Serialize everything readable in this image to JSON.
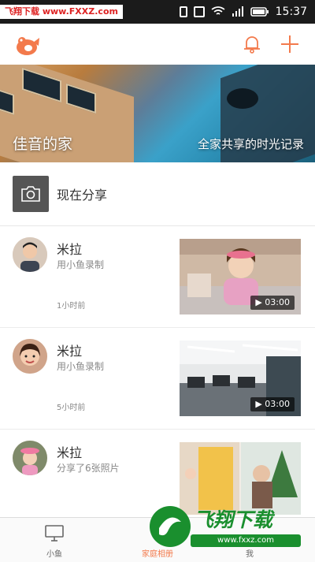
{
  "status_bar": {
    "watermark": "飞翔下载 www.FXXZ.com",
    "time": "15:37"
  },
  "app_bar": {
    "logo_icon": "fish-logo-icon",
    "bell_icon": "bell-icon",
    "add_icon": "plus-icon",
    "accent": "#f37a4c"
  },
  "banner": {
    "title": "佳音的家",
    "subtitle": "全家共享的时光记录"
  },
  "share_row": {
    "label": "现在分享",
    "icon": "camera-icon"
  },
  "feed": [
    {
      "name": "米拉",
      "action": "用小鱼录制",
      "time": "1小时前",
      "duration": "03:00",
      "type": "video"
    },
    {
      "name": "米拉",
      "action": "用小鱼录制",
      "time": "5小时前",
      "duration": "03:00",
      "type": "video"
    },
    {
      "name": "米拉",
      "action": "分享了6张照片",
      "time": "",
      "duration": "",
      "type": "photos"
    }
  ],
  "bottom_nav": {
    "items": [
      {
        "label": "小鱼",
        "icon": "monitor-icon"
      },
      {
        "label": "家庭相册",
        "icon": "album-icon"
      },
      {
        "label": "我",
        "icon": "person-icon"
      }
    ]
  },
  "watermark_bottom": {
    "brand": "飞翔下载",
    "url": "www.fxxz.com"
  }
}
